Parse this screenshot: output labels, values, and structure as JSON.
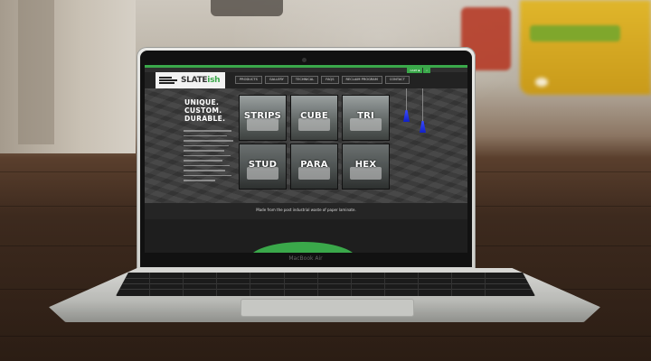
{
  "scene": {
    "laptop_brand": "MacBook Air"
  },
  "website": {
    "logo": {
      "prefix": "SLATE",
      "suffix": "ish"
    },
    "utility_bar": [
      {
        "label": "CART",
        "icon": "cart-icon"
      },
      {
        "label": "",
        "icon": "search-icon"
      }
    ],
    "nav": [
      {
        "label": "PRODUCTS",
        "highlight": false
      },
      {
        "label": "GALLERY",
        "highlight": false
      },
      {
        "label": "TECHNICAL",
        "highlight": false
      },
      {
        "label": "FAQS",
        "highlight": false
      },
      {
        "label": "RECLAIM PROGRAM",
        "highlight": false
      },
      {
        "label": "CONTACT",
        "highlight": false
      }
    ],
    "tagline": [
      "UNIQUE.",
      "CUSTOM.",
      "DURABLE."
    ],
    "tiles": [
      "STRIPS",
      "CUBE",
      "TRI",
      "STUD",
      "PARA",
      "HEX"
    ],
    "strip_caption": "Made from the post industrial waste of paper laminate.",
    "colors": {
      "accent": "#3aa84a",
      "dark": "#222222",
      "lamp": "#2030e0"
    }
  }
}
